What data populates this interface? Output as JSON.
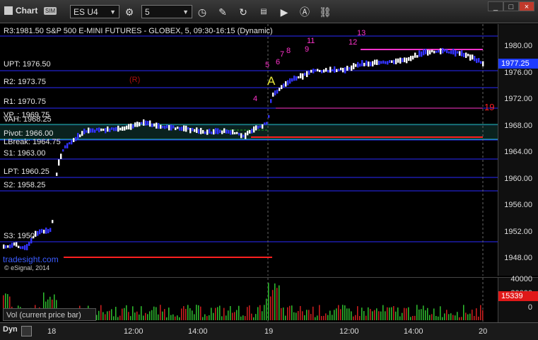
{
  "toolbar": {
    "title": "Chart",
    "badge": "SIM",
    "symbol": "ES U4",
    "interval": "5",
    "win_min": "_",
    "win_max": "□",
    "win_close": "×"
  },
  "chart": {
    "header": "R3:1981.50 S&P 500 E-MINI FUTURES - GLOBEX, 5, 09:30-16:15 (Dynamic)",
    "levels": [
      {
        "name": "UPT",
        "label": "UPT: 1976.50"
      },
      {
        "name": "R2",
        "label": "R2: 1973.75"
      },
      {
        "name": "R1",
        "label": "R1: 1970.75"
      },
      {
        "name": "VAL",
        "label": "VP..: 1969.75"
      },
      {
        "name": "VAH",
        "label": "VAH: 1968.25"
      },
      {
        "name": "Pivot",
        "label": "Pivot: 1966.00"
      },
      {
        "name": "LBreak",
        "label": "LBreak: 1964.75"
      },
      {
        "name": "S1",
        "label": "S1: 1963.00"
      },
      {
        "name": "LPT",
        "label": "LPT: 1960.25"
      },
      {
        "name": "S2",
        "label": "S2: 1958.25"
      },
      {
        "name": "S3",
        "label": "S3: 1950"
      }
    ],
    "annotations": {
      "r_marker": "(R)",
      "a_marker": "A",
      "count_19": "19",
      "count_13": "13",
      "count_12": "12",
      "count_11": "11",
      "count_9": "9",
      "count_8": "8",
      "count_7": "7",
      "count_6": "6",
      "count_5": "5",
      "count_4": "4",
      "watermark": "tradesight.com",
      "copyright": "© eSignal, 2014"
    },
    "price_axis": [
      "1980.00",
      "1976.00",
      "1972.00",
      "1968.00",
      "1964.00",
      "1960.00",
      "1956.00",
      "1952.00",
      "1948.00"
    ],
    "last_price": "1977.25",
    "colors": {
      "level_line": "#2a2aff",
      "up_bar": "#ffffff",
      "down_bar": "#3333ff",
      "red_line": "#ff2020",
      "magenta": "#ff33cc",
      "green_count": "#22aa22"
    }
  },
  "volume": {
    "title": "Vol (current price bar)",
    "axis": [
      "40000",
      "20000",
      "0"
    ],
    "last": "15339"
  },
  "time_axis": {
    "mode": "Dyn",
    "labels": [
      "18",
      "12:00",
      "14:00",
      "19",
      "12:00",
      "14:00",
      "20"
    ]
  }
}
